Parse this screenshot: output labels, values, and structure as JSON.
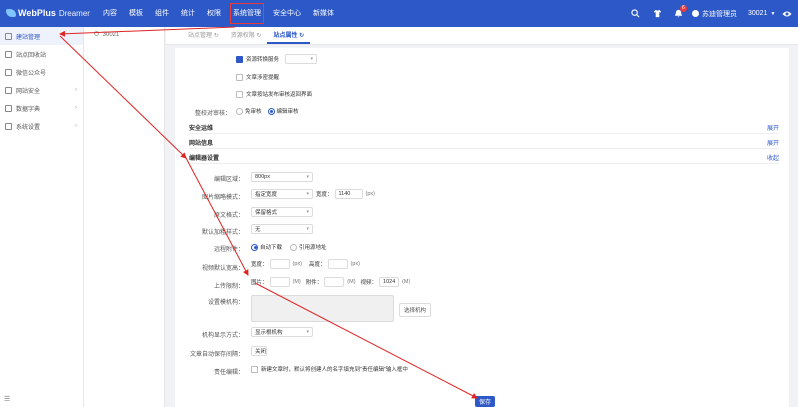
{
  "topbar": {
    "brand": "WebPlus",
    "brand_sub": "Dreamer",
    "nav": [
      "内容",
      "模板",
      "组件",
      "统计",
      "权限",
      "系统管理",
      "安全中心",
      "新媒体"
    ],
    "highlighted": "系统管理",
    "notif_count": "6",
    "user": "苏迪管理员",
    "site": "30021"
  },
  "sidebar": {
    "items": [
      {
        "label": "建站管理",
        "active": true,
        "has_children": false
      },
      {
        "label": "站点回收站",
        "active": false,
        "has_children": false
      },
      {
        "label": "微信公众号",
        "active": false,
        "has_children": false
      },
      {
        "label": "网站安全",
        "active": false,
        "has_children": true
      },
      {
        "label": "数据字典",
        "active": false,
        "has_children": true
      },
      {
        "label": "系统设置",
        "active": false,
        "has_children": true
      }
    ]
  },
  "tree": {
    "node": "30021"
  },
  "tabs": [
    {
      "label": "站点管理",
      "active": false
    },
    {
      "label": "资源权限",
      "active": false
    },
    {
      "label": "站点属性",
      "active": true
    }
  ],
  "upper": {
    "resource_convert": "资源转换服务",
    "article_push": "文章涉密提醒",
    "publish_nav": "文章按站发布审核返回界面",
    "review_label": "整校对审核：",
    "review_opt1": "免审核",
    "review_opt2": "编辑审核"
  },
  "sections": [
    {
      "title": "安全运维",
      "action": "展开"
    },
    {
      "title": "网站信息",
      "action": "展开"
    },
    {
      "title": "编辑器设置",
      "action": "收起"
    }
  ],
  "editor": {
    "area_label": "编辑区域：",
    "area_value": "800px",
    "img_mode_label": "图片缩略模式：",
    "img_mode_value": "指定宽度",
    "width_label": "宽度：",
    "width_value": "1140",
    "px": "(px)",
    "text_style_label": "原文格式：",
    "text_style_value": "保留格式",
    "default_style_label": "默认加粗样式：",
    "default_style_value": "无",
    "remote_label": "远程附件：",
    "remote_opt1": "自动下载",
    "remote_opt2": "引用源地址",
    "video_label": "视频默认宽高：",
    "video_w": "宽度：",
    "video_h": "高度：",
    "upload_label": "上传限制：",
    "upload_img": "图片：",
    "upload_att": "附件：",
    "upload_video": "视频：",
    "upload_video_val": "1024",
    "m": "(M)",
    "org_label": "设置模机构：",
    "org_btn": "选择机构",
    "org_display_label": "机构显示方式：",
    "org_display_value": "显示根机构",
    "autosave_label": "文章自动保存间隔：",
    "autosave_value": "关闭",
    "editor_label": "责任编辑：",
    "editor_text": "新建文章时，默认将创建人的名字填充到\"责任编辑\"输入框中"
  },
  "save_label": "保存"
}
